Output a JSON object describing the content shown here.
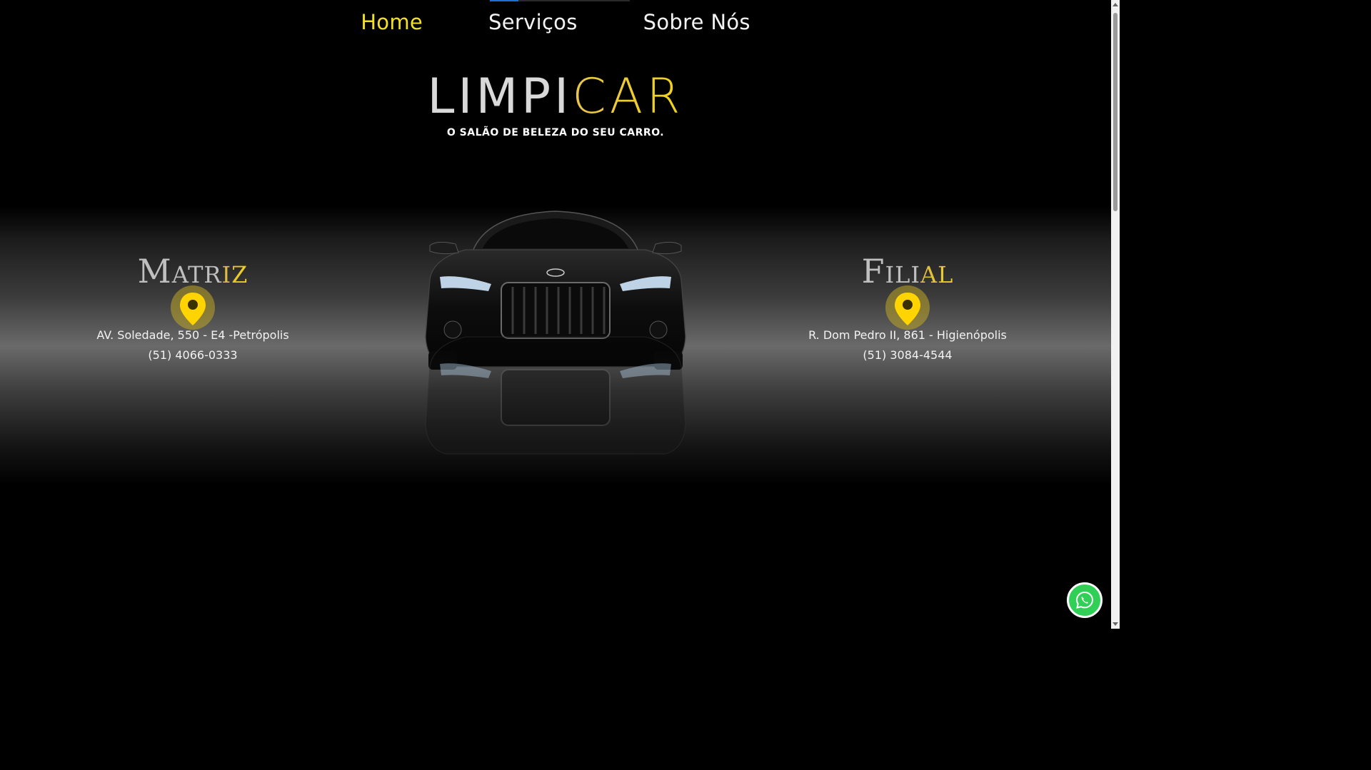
{
  "nav": {
    "items": [
      {
        "label": "Home",
        "active": true
      },
      {
        "label": "Serviços",
        "active": false
      },
      {
        "label": "Sobre Nós",
        "active": false
      }
    ]
  },
  "brand": {
    "title_part1": "LIMPI",
    "title_part2": "CAR",
    "tagline": "O SALÃO DE BELEZA DO SEU CARRO."
  },
  "locations": {
    "matriz": {
      "title_part1": "Matr",
      "title_part2": "iz",
      "address": "AV. Soledade, 550 - E4 -Petrópolis",
      "phone": "(51) 4066-0333",
      "icon": "map-pin-icon"
    },
    "filial": {
      "title_part1": "Fili",
      "title_part2": "al",
      "address": "R. Dom Pedro II, 861 - Higienópolis",
      "phone": "(51) 3084-4544",
      "icon": "map-pin-icon"
    }
  },
  "colors": {
    "accent": "#f1e025",
    "background": "#000000",
    "whatsapp": "#2fd055"
  },
  "floating": {
    "icon": "whatsapp-icon"
  }
}
